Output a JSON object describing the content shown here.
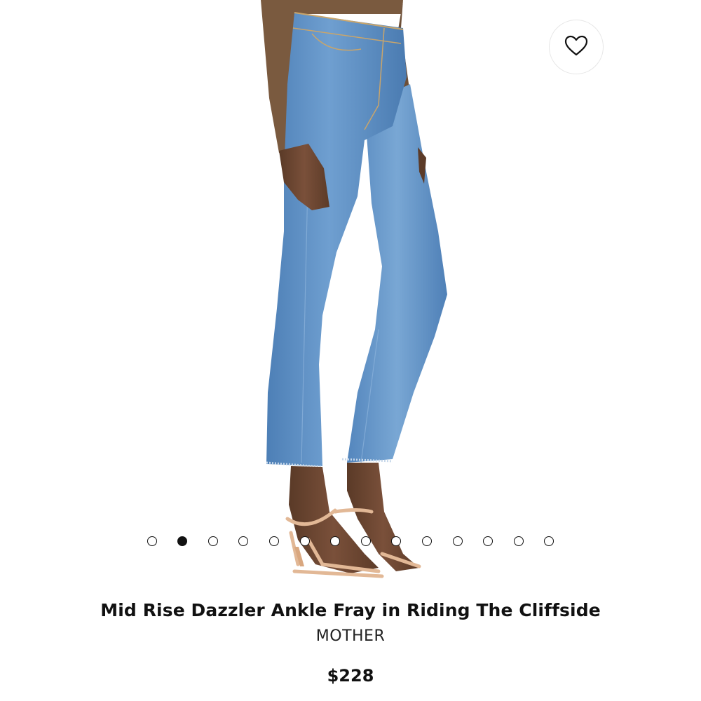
{
  "product": {
    "title": "Mid Rise Dazzler Ankle Fray in Riding The Cliffside",
    "brand": "MOTHER",
    "price": "$228"
  },
  "gallery": {
    "image_count": 14,
    "active_index": 1
  },
  "icons": {
    "favorite": "heart-outline-icon"
  },
  "colors": {
    "denim": "#5b8fc4",
    "sweater": "#7a5a3f",
    "skin": "#6b4630",
    "sandal": "#e2b896",
    "text": "#111111",
    "background": "#ffffff"
  }
}
